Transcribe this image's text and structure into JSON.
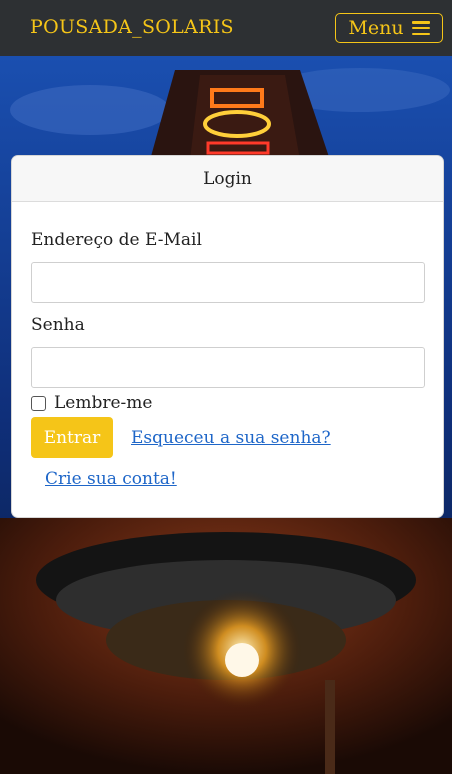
{
  "navbar": {
    "brand": "POUSADA_SOLARIS",
    "menu_label": "Menu",
    "accent": "#f5c518",
    "background": "#2d3033"
  },
  "background_image": {
    "icon": "hotel-neon-sign-lamp-photo"
  },
  "login": {
    "title": "Login",
    "email_label": "Endereço de E-Mail",
    "email_value": "",
    "password_label": "Senha",
    "password_value": "",
    "remember_label": "Lembre-me",
    "remember_checked": false,
    "submit_label": "Entrar",
    "forgot_link": "Esqueceu a sua senha?",
    "register_link": "Crie sua conta!",
    "button_color": "#f5c518",
    "link_color": "#1e66c8"
  }
}
